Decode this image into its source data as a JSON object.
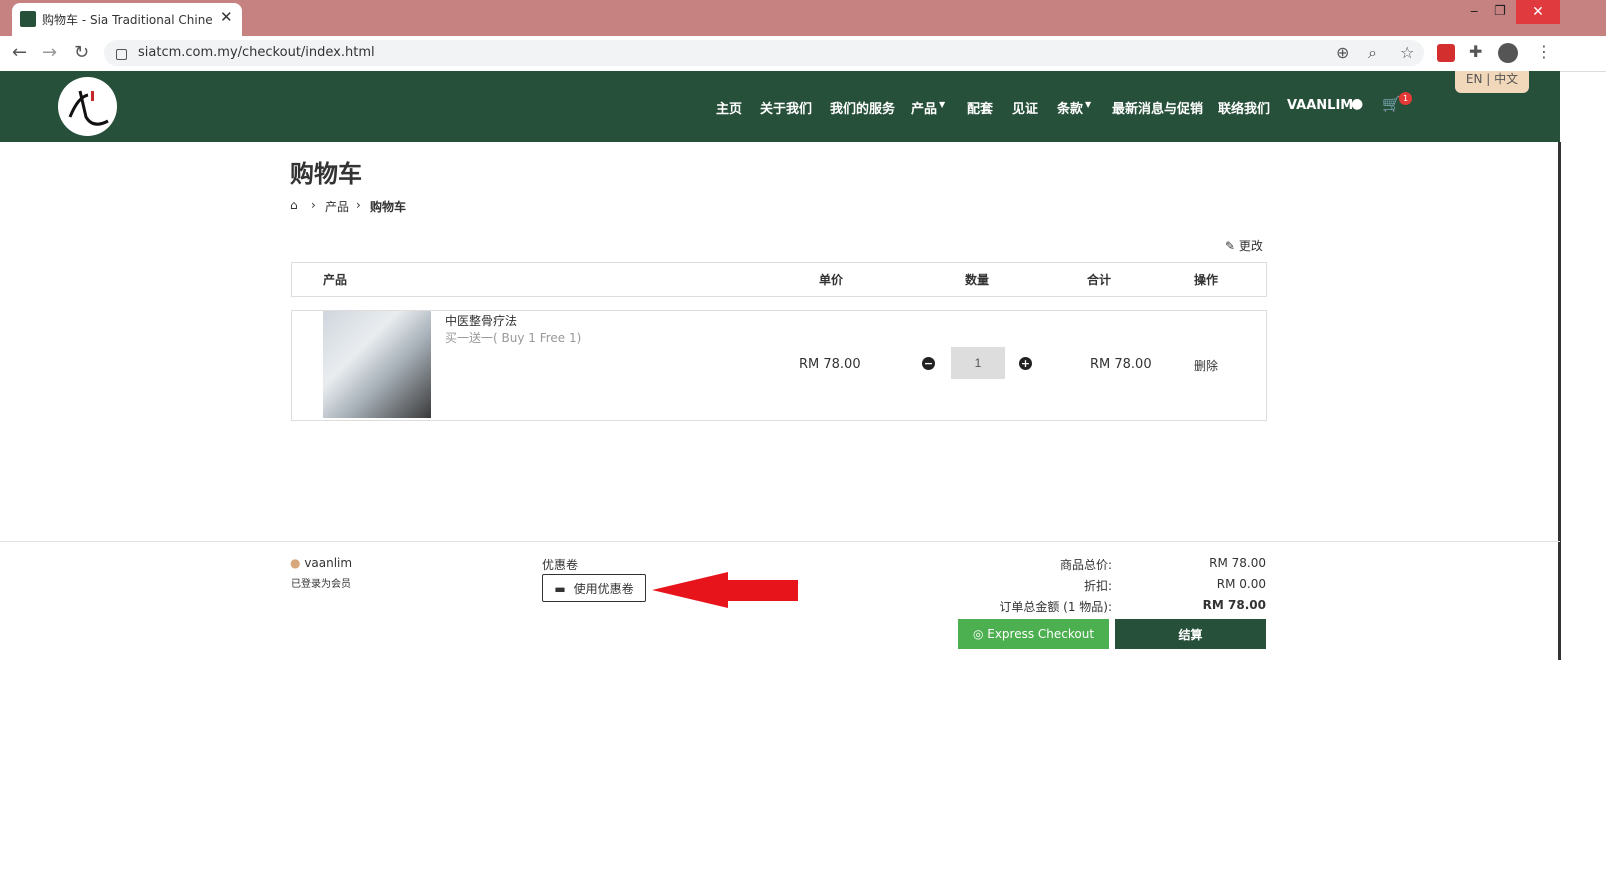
{
  "browser": {
    "tab_title": "购物车 - Sia Traditional Chinese",
    "url": "siatcm.com.my/checkout/index.html"
  },
  "header": {
    "nav": [
      "主页",
      "关于我们",
      "我们的服务",
      "产品",
      "配套",
      "见证",
      "条款",
      "最新消息与促销",
      "联络我们"
    ],
    "user": "VAANLIM",
    "cart_count": "1",
    "lang": "EN | 中文"
  },
  "page": {
    "title": "购物车",
    "breadcrumb": [
      "产品",
      "购物车"
    ],
    "edit_label": "更改"
  },
  "table": {
    "headers": [
      "产品",
      "单价",
      "数量",
      "合计",
      "操作"
    ],
    "rows": [
      {
        "name": "中医整骨疗法",
        "variant": "买一送一( Buy 1 Free 1)",
        "price": "RM 78.00",
        "qty": "1",
        "total": "RM 78.00",
        "action": "删除"
      }
    ]
  },
  "footer": {
    "username": "vaanlim",
    "member_status": "已登录为会员",
    "coupon_label": "优惠卷",
    "coupon_button": "使用优惠卷",
    "summary": [
      {
        "label": "商品总价:",
        "value": "RM 78.00"
      },
      {
        "label": "折扣:",
        "value": "RM 0.00"
      },
      {
        "label": "订单总金额 (1 物品):",
        "value": "RM 78.00"
      }
    ],
    "express_label": "Express Checkout",
    "checkout_label": "结算"
  },
  "colors": {
    "brand_green": "#27503a",
    "express_green": "#4caf50",
    "arrow_red": "#e8141c",
    "tabbar": "#c68181"
  }
}
